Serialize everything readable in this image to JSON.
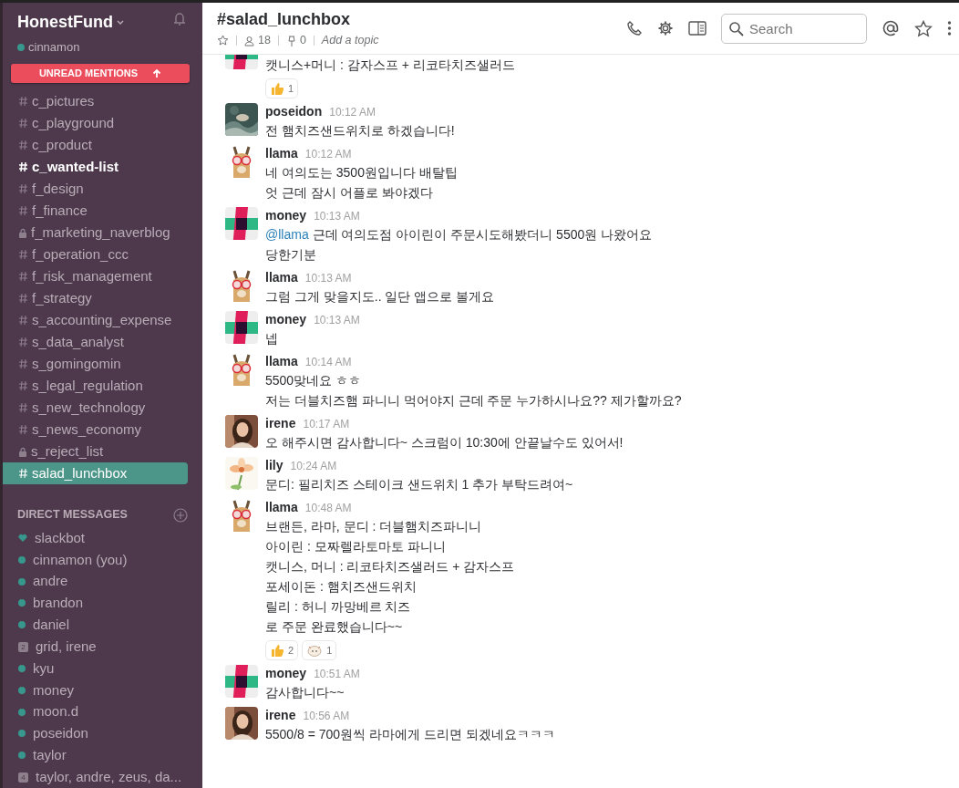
{
  "team": {
    "name": "HonestFund",
    "user": "cinnamon",
    "online": true
  },
  "unread_banner": "UNREAD MENTIONS",
  "channels": [
    {
      "name": "c_pictures",
      "private": false,
      "unread": false,
      "selected": false
    },
    {
      "name": "c_playground",
      "private": false,
      "unread": false,
      "selected": false
    },
    {
      "name": "c_product",
      "private": false,
      "unread": false,
      "selected": false
    },
    {
      "name": "c_wanted-list",
      "private": false,
      "unread": true,
      "selected": false
    },
    {
      "name": "f_design",
      "private": false,
      "unread": false,
      "selected": false
    },
    {
      "name": "f_finance",
      "private": false,
      "unread": false,
      "selected": false
    },
    {
      "name": "f_marketing_naverblog",
      "private": true,
      "unread": false,
      "selected": false
    },
    {
      "name": "f_operation_ccc",
      "private": false,
      "unread": false,
      "selected": false
    },
    {
      "name": "f_risk_management",
      "private": false,
      "unread": false,
      "selected": false
    },
    {
      "name": "f_strategy",
      "private": false,
      "unread": false,
      "selected": false
    },
    {
      "name": "s_accounting_expense",
      "private": false,
      "unread": false,
      "selected": false
    },
    {
      "name": "s_data_analyst",
      "private": false,
      "unread": false,
      "selected": false
    },
    {
      "name": "s_gomingomin",
      "private": false,
      "unread": false,
      "selected": false
    },
    {
      "name": "s_legal_regulation",
      "private": false,
      "unread": false,
      "selected": false
    },
    {
      "name": "s_new_technology",
      "private": false,
      "unread": false,
      "selected": false
    },
    {
      "name": "s_news_economy",
      "private": false,
      "unread": false,
      "selected": false
    },
    {
      "name": "s_reject_list",
      "private": true,
      "unread": false,
      "selected": false
    },
    {
      "name": "salad_lunchbox",
      "private": false,
      "unread": false,
      "selected": true
    }
  ],
  "direct_messages": {
    "title": "DIRECT MESSAGES",
    "items": [
      {
        "name": "slackbot",
        "kind": "bot"
      },
      {
        "name": "cinnamon (you)",
        "kind": "user"
      },
      {
        "name": "andre",
        "kind": "user"
      },
      {
        "name": "brandon",
        "kind": "user"
      },
      {
        "name": "daniel",
        "kind": "user"
      },
      {
        "name": "grid, irene",
        "kind": "group",
        "count": "2"
      },
      {
        "name": "kyu",
        "kind": "user"
      },
      {
        "name": "money",
        "kind": "user"
      },
      {
        "name": "moon.d",
        "kind": "user"
      },
      {
        "name": "poseidon",
        "kind": "user"
      },
      {
        "name": "taylor",
        "kind": "user"
      },
      {
        "name": "taylor, andre, zeus, da...",
        "kind": "group",
        "count": "4"
      }
    ]
  },
  "header": {
    "title": "#salad_lunchbox",
    "members": "18",
    "pins": "0",
    "topic": "Add a topic",
    "search_placeholder": "Search"
  },
  "messages": [
    {
      "avatar": {
        "kind": "money"
      },
      "lines": [
        {
          "text": "캣니스+머니 : 감자스프 + 리코타치즈샐러드"
        }
      ],
      "reactions": [
        {
          "kind": "thumbs_up",
          "count": "1"
        }
      ]
    },
    {
      "author": "poseidon",
      "time": "10:12 AM",
      "avatar": {
        "kind": "poseidon"
      },
      "lines": [
        {
          "text": "전 햄치즈샌드위치로 하겠습니다!"
        }
      ]
    },
    {
      "author": "llama",
      "time": "10:12 AM",
      "avatar": {
        "kind": "llama"
      },
      "lines": [
        {
          "text": "네 여의도는 3500원입니다 배탈팁"
        },
        {
          "text": "엇 근데 잠시 어플로 봐야겠다"
        }
      ]
    },
    {
      "author": "money",
      "time": "10:13 AM",
      "avatar": {
        "kind": "money"
      },
      "lines": [
        {
          "mention": "@llama",
          "text": " 근데 여의도점 아이린이 주문시도해봤더니 5500원 나왔어요"
        },
        {
          "text": "당한기분"
        }
      ]
    },
    {
      "author": "llama",
      "time": "10:13 AM",
      "avatar": {
        "kind": "llama"
      },
      "lines": [
        {
          "text": "그럼 그게 맞을지도.. 일단 앱으로 볼게요"
        }
      ]
    },
    {
      "author": "money",
      "time": "10:13 AM",
      "avatar": {
        "kind": "money"
      },
      "lines": [
        {
          "text": "넵"
        }
      ]
    },
    {
      "author": "llama",
      "time": "10:14 AM",
      "avatar": {
        "kind": "llama"
      },
      "lines": [
        {
          "text": "5500맞네요 ㅎㅎ"
        },
        {
          "text": "저는 더블치즈햄 파니니 먹어야지 근데 주문 누가하시나요?? 제가할까요?"
        }
      ]
    },
    {
      "author": "irene",
      "time": "10:17 AM",
      "avatar": {
        "kind": "irene"
      },
      "lines": [
        {
          "text": "오 해주시면 감사합니다~ 스크럼이 10:30에 안끝날수도 있어서!"
        }
      ]
    },
    {
      "author": "lily",
      "time": "10:24 AM",
      "avatar": {
        "kind": "lily"
      },
      "lines": [
        {
          "text": "문디: 필리치즈 스테이크 샌드위치 1 추가 부탁드려여~"
        }
      ]
    },
    {
      "author": "llama",
      "time": "10:48 AM",
      "avatar": {
        "kind": "llama"
      },
      "lines": [
        {
          "text": "브랜든, 라마, 문디 : 더블햄치즈파니니"
        },
        {
          "text": "아이린 : 모짜렐라토마토 파니니"
        },
        {
          "text": "캣니스, 머니 : 리코타치즈샐러드 + 감자스프"
        },
        {
          "text": "포세이돈 : 햄치즈샌드위치"
        },
        {
          "text": "릴리 : 허니 까망베르 치즈"
        },
        {
          "text": "로 주문 완료했습니다~~"
        }
      ],
      "reactions": [
        {
          "kind": "thumbs_up",
          "count": "2"
        },
        {
          "kind": "sticker",
          "count": "1"
        }
      ]
    },
    {
      "author": "money",
      "time": "10:51 AM",
      "avatar": {
        "kind": "money"
      },
      "lines": [
        {
          "text": "감사합니다~~"
        }
      ]
    },
    {
      "author": "irene",
      "time": "10:56 AM",
      "avatar": {
        "kind": "irene"
      },
      "lines": [
        {
          "text": "5500/8 = 700원씩 라마에게 드리면 되겠네요ㅋㅋㅋ"
        }
      ]
    }
  ]
}
